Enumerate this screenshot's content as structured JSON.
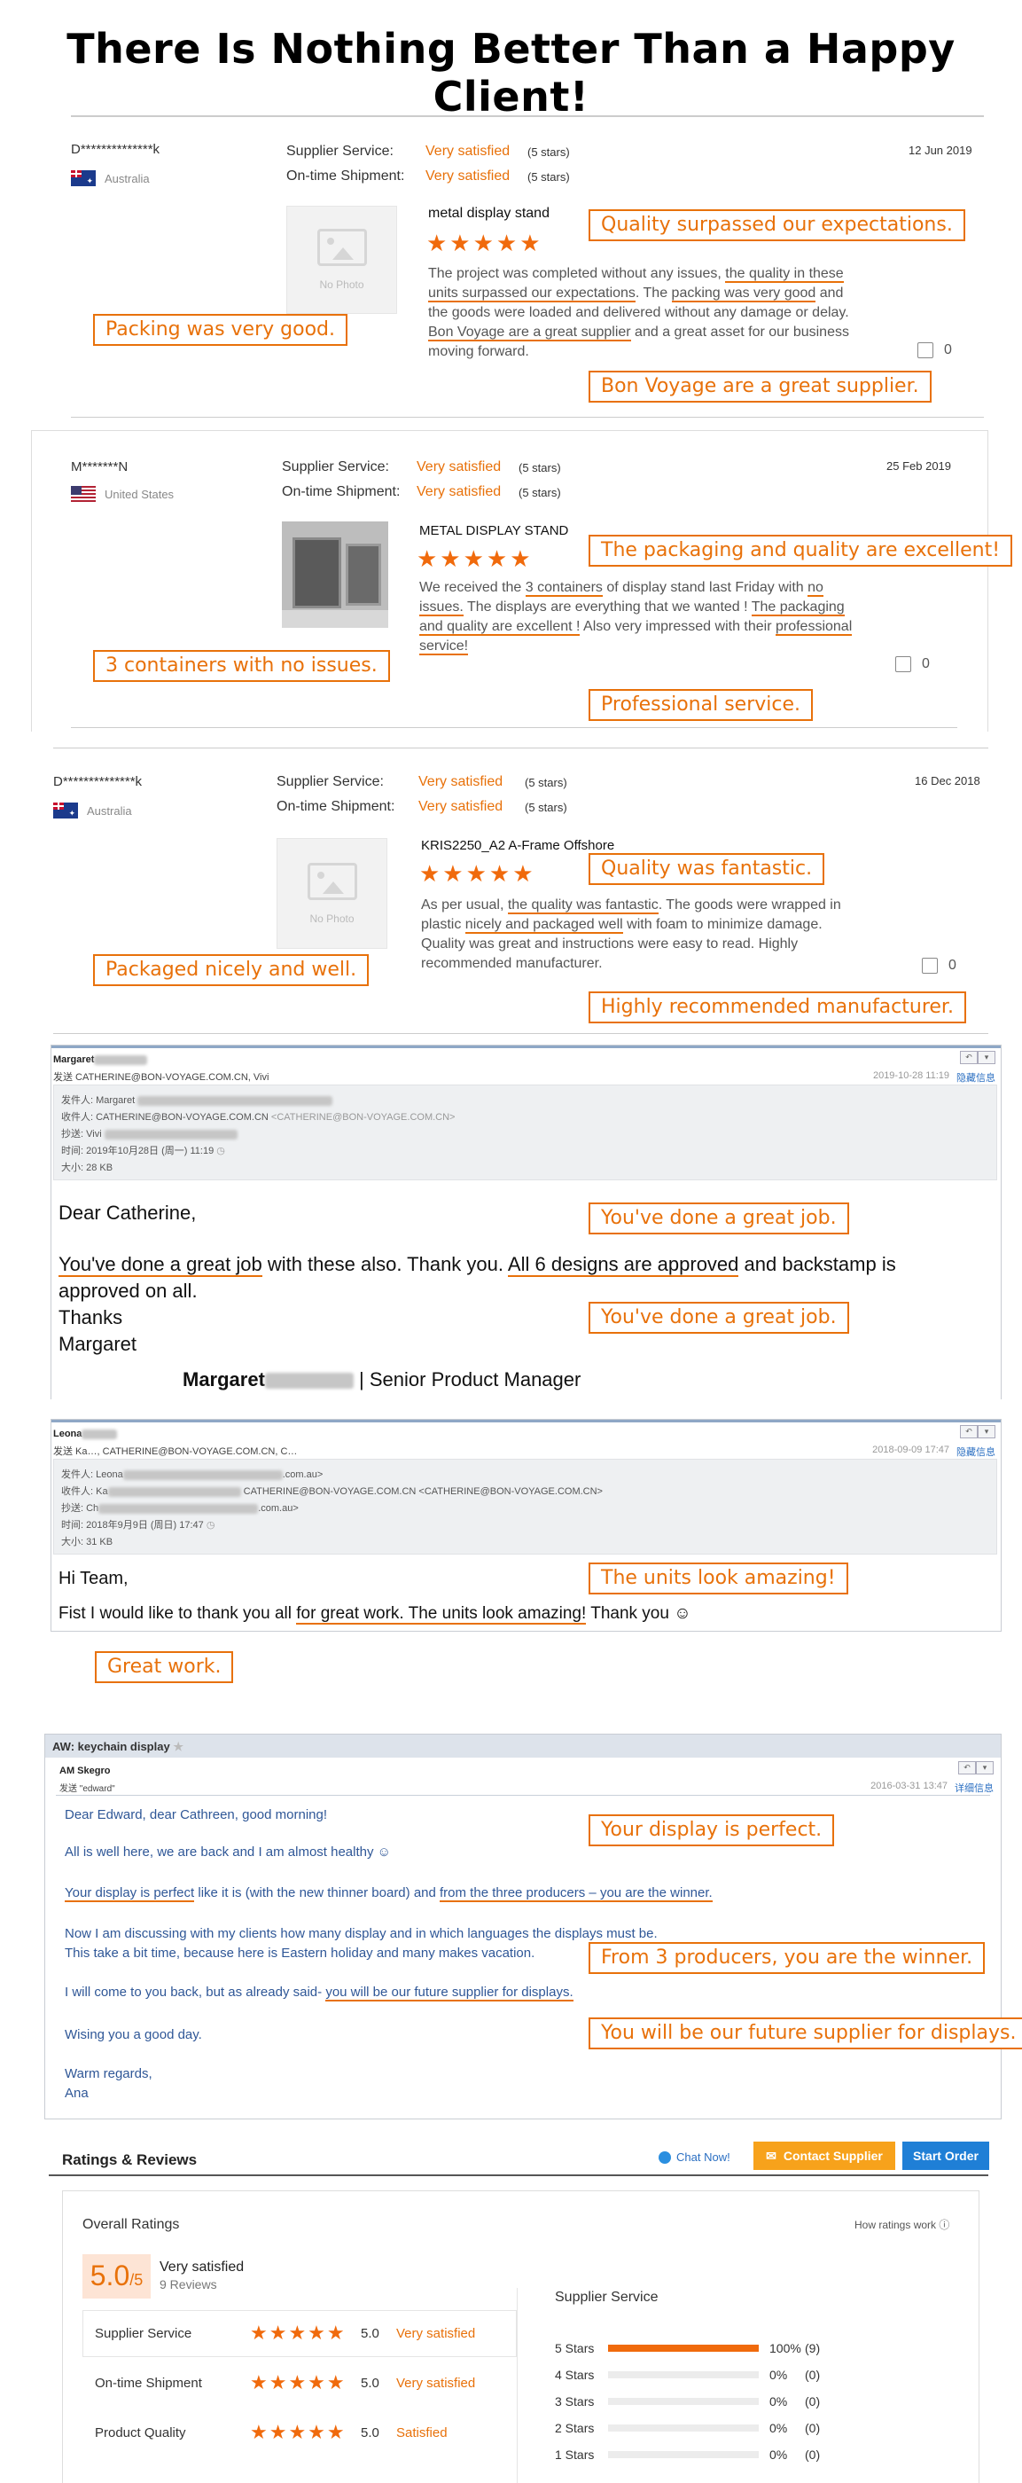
{
  "page_title": "There Is Nothing Better Than a Happy Client!",
  "colors": {
    "accent": "#e8710a",
    "star": "#f06a0c",
    "link": "#2b6fc2"
  },
  "reviews": [
    {
      "name": "D**************k",
      "country": "Australia",
      "flag": "australia-flag",
      "service_label": "Supplier Service:",
      "service_value": "Very satisfied",
      "service_stars": "(5 stars)",
      "shipment_label": "On-time Shipment:",
      "shipment_value": "Very satisfied",
      "shipment_stars": "(5 stars)",
      "date": "12 Jun 2019",
      "product": "metal display stand",
      "photo": "No Photo",
      "rating": 5,
      "text_parts": [
        {
          "t": "The project was completed without any issues, ",
          "u": false
        },
        {
          "t": "the quality in these units surpassed our expectations",
          "u": true
        },
        {
          "t": ". The ",
          "u": false
        },
        {
          "t": "packing was very good",
          "u": true
        },
        {
          "t": " and the goods were loaded and delivered without any damage or delay. ",
          "u": false
        },
        {
          "t": "Bon Voyage are a great supplier",
          "u": true
        },
        {
          "t": " and a great asset for our business moving forward.",
          "u": false
        }
      ],
      "likes": "0",
      "callouts": [
        "Quality surpassed our expectations.",
        "Packing was very good.",
        "Bon Voyage are a great supplier."
      ]
    },
    {
      "name": "M*******N",
      "country": "United States",
      "flag": "usa-flag",
      "service_label": "Supplier Service:",
      "service_value": "Very satisfied",
      "service_stars": "(5 stars)",
      "shipment_label": "On-time Shipment:",
      "shipment_value": "Very satisfied",
      "shipment_stars": "(5 stars)",
      "date": "25 Feb 2019",
      "product": "METAL DISPLAY STAND",
      "rating": 5,
      "text_parts": [
        {
          "t": "We received the ",
          "u": false
        },
        {
          "t": "3 containers",
          "u": true
        },
        {
          "t": " of display stand last Friday with ",
          "u": false
        },
        {
          "t": "no issues.",
          "u": true
        },
        {
          "t": " The displays are everything that we wanted ! ",
          "u": false
        },
        {
          "t": "The packaging and quality are excellent !",
          "u": true
        },
        {
          "t": " Also very impressed with their ",
          "u": false
        },
        {
          "t": "professional service!",
          "u": true
        }
      ],
      "likes": "0",
      "callouts": [
        "The packaging and quality are excellent!",
        "3 containers with no issues.",
        "Professional service."
      ]
    },
    {
      "name": "D**************k",
      "country": "Australia",
      "flag": "australia-flag",
      "service_label": "Supplier Service:",
      "service_value": "Very satisfied",
      "service_stars": "(5 stars)",
      "shipment_label": "On-time Shipment:",
      "shipment_value": "Very satisfied",
      "shipment_stars": "(5 stars)",
      "date": "16 Dec 2018",
      "product": "KRIS2250_A2 A-Frame Offshore",
      "photo": "No Photo",
      "rating": 5,
      "text_parts": [
        {
          "t": "As per usual, ",
          "u": false
        },
        {
          "t": "the quality was fantastic",
          "u": true
        },
        {
          "t": ". The goods were wrapped in plastic ",
          "u": false
        },
        {
          "t": "nicely and packaged well",
          "u": true
        },
        {
          "t": " with foam to minimize damage. Quality was great and instructions were easy to read. Highly recommended manufacturer.",
          "u": false
        }
      ],
      "likes": "0",
      "callouts": [
        "Quality was fantastic.",
        "Packaged nicely and well.",
        "Highly recommended manufacturer."
      ]
    }
  ],
  "email1": {
    "sender": "Margaret",
    "addr_line": "发送 CATHERINE@BON-VOYAGE.COM.CN, Vivi",
    "date": "2019-10-28 11:19",
    "hide_link": "隐藏信息",
    "meta": [
      {
        "k": "发件人: Margaret",
        "v": ""
      },
      {
        "k": "收件人: CATHERINE@BON-VOYAGE.COM.CN",
        "v": "<CATHERINE@BON-VOYAGE.COM.CN>"
      },
      {
        "k": "抄送: Vivi",
        "v": ""
      },
      {
        "k": "时间: 2019年10月28日 (周一) 11:19",
        "v": ""
      },
      {
        "k": "大小: 28 KB",
        "v": ""
      }
    ],
    "greeting": "Dear Catherine,",
    "body_parts": [
      {
        "t": "You've done a great job",
        "u": true
      },
      {
        "t": " with these also. Thank you. ",
        "u": false
      },
      {
        "t": "All 6 designs are approved",
        "u": true
      },
      {
        "t": " and backstamp is approved on all.",
        "u": false
      }
    ],
    "thanks": "Thanks",
    "signoff": "Margaret",
    "signature_name": "Margaret",
    "signature_title": "| Senior Product Manager",
    "callouts": [
      "You've done a great job.",
      "You've done a great job."
    ]
  },
  "email2": {
    "sender": "Leona",
    "addr_line": "发送 Ka…, CATHERINE@BON-VOYAGE.COM.CN, C…",
    "date": "2018-09-09 17:47",
    "hide_link": "隐藏信息",
    "meta": [
      {
        "k": "发件人: Leona",
        "v": ".com.au>"
      },
      {
        "k": "收件人: Ka",
        "v": "CATHERINE@BON-VOYAGE.COM.CN <CATHERINE@BON-VOYAGE.COM.CN>"
      },
      {
        "k": "抄送: Ch",
        "v": ".com.au>"
      },
      {
        "k": "时间: 2018年9月9日 (周日) 17:47",
        "v": ""
      },
      {
        "k": "大小: 31 KB",
        "v": ""
      }
    ],
    "greeting": "Hi Team,",
    "body_parts": [
      {
        "t": "Fist I would like to thank you all ",
        "u": false
      },
      {
        "t": "for great work. The units look amazing!",
        "u": true
      },
      {
        "t": " Thank you ☺",
        "u": false
      }
    ],
    "callouts": [
      "The units look amazing!",
      "Great work."
    ]
  },
  "email3": {
    "subject": "AW: keychain display",
    "sender": "AM Skegro",
    "addr_line": "发送 \"edward\"",
    "date": "2016-03-31 13:47",
    "detail_link": "详细信息",
    "lines": [
      {
        "parts": [
          {
            "t": "Dear Edward, dear Cathreen, good morning!",
            "u": false
          }
        ]
      },
      {
        "parts": [
          {
            "t": "All is well here, we are back and I am almost healthy ☺",
            "u": false
          }
        ]
      },
      {
        "parts": [
          {
            "t": "Your display is perfect",
            "u": true
          },
          {
            "t": " like it is (with the new thinner board) and ",
            "u": false
          },
          {
            "t": "from the three producers – you are the winner.",
            "u": true
          }
        ]
      },
      {
        "parts": [
          {
            "t": "Now I am discussing with my clients how many display and in which languages the displays must be.",
            "u": false
          }
        ]
      },
      {
        "parts": [
          {
            "t": "This take a bit time, because here is Eastern holiday and many makes vacation.",
            "u": false
          }
        ]
      },
      {
        "parts": [
          {
            "t": "I will come to you back, but as already said- ",
            "u": false
          },
          {
            "t": "you will be our future supplier for displays.",
            "u": true
          }
        ]
      },
      {
        "parts": [
          {
            "t": "Wising you a good day.",
            "u": false
          }
        ]
      },
      {
        "parts": [
          {
            "t": "Warm regards,",
            "u": false
          }
        ]
      },
      {
        "parts": [
          {
            "t": "Ana",
            "u": false
          }
        ]
      }
    ],
    "callouts": [
      "Your display is perfect.",
      "From 3 producers, you are the winner.",
      "You will be our future supplier for displays."
    ]
  },
  "ratings": {
    "header": "Ratings & Reviews",
    "chat": "Chat Now!",
    "contact": "Contact Supplier",
    "order": "Start Order",
    "overall_title": "Overall Ratings",
    "how_works": "How ratings work ⓘ",
    "score": "5.0",
    "score_max": "/5",
    "summary": "Very satisfied",
    "review_count": "9 Reviews",
    "categories": [
      {
        "name": "Supplier Service",
        "value": "5.0",
        "desc": "Very satisfied",
        "rating": 5
      },
      {
        "name": "On-time Shipment",
        "value": "5.0",
        "desc": "Very satisfied",
        "rating": 5
      },
      {
        "name": "Product Quality",
        "value": "5.0",
        "desc": "Satisfied",
        "rating": 5
      }
    ],
    "dist_title": "Supplier Service",
    "distribution": [
      {
        "label": "5 Stars",
        "pct": "100%",
        "count": "(9)",
        "fraction": 1.0
      },
      {
        "label": "4 Stars",
        "pct": "0%",
        "count": "(0)",
        "fraction": 0
      },
      {
        "label": "3 Stars",
        "pct": "0%",
        "count": "(0)",
        "fraction": 0
      },
      {
        "label": "2 Stars",
        "pct": "0%",
        "count": "(0)",
        "fraction": 0
      },
      {
        "label": "1 Stars",
        "pct": "0%",
        "count": "(0)",
        "fraction": 0
      }
    ]
  }
}
